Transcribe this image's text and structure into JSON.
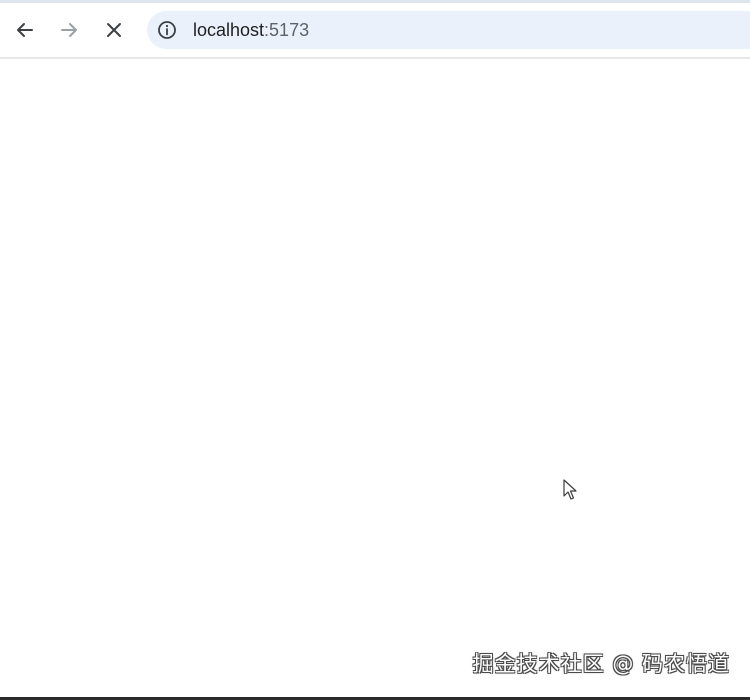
{
  "browser": {
    "address_bar": {
      "host": "localhost",
      "port": ":5173"
    },
    "nav": {
      "back": "back-arrow-icon",
      "forward": "forward-arrow-icon",
      "stop": "close-icon"
    }
  },
  "overlay": {
    "watermark": "掘金技术社区 @ 码农悟道"
  },
  "colors": {
    "omnibox_bg": "#eaf1fb",
    "page_bg": "#ffffff",
    "icon_active": "#3c4043",
    "icon_disabled": "#9aa0a6"
  }
}
